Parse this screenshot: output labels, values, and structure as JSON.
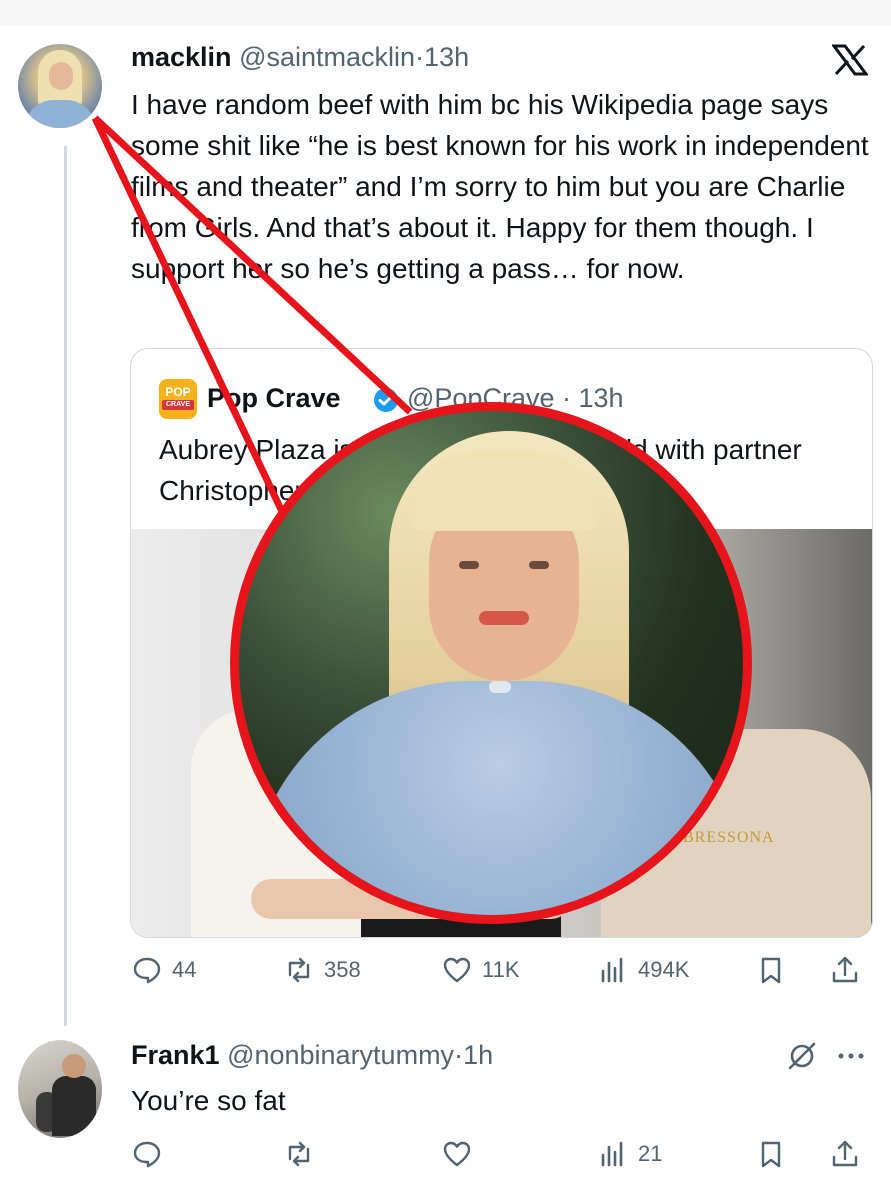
{
  "tweet": {
    "name": "macklin",
    "handle": "@saintmacklin",
    "separator": "·",
    "time": "13h",
    "text": "I have random beef with him bc his Wikipedia page says some shit like “he is best known for his work in independent films and theater” and I’m sorry to him but you are Charlie from Girls. And that’s about it. Happy for them though. I support her so he’s getting a pass… for now.",
    "stats": {
      "replies": "44",
      "reposts": "358",
      "likes": "11K",
      "views": "494K"
    }
  },
  "quote": {
    "logo_text": "POP",
    "logo_subtext": "CRAVE",
    "name": "Pop Crave",
    "handle": "@PopCrave · 13h",
    "text": "Aubrey Plaza is expecting her first child with partner Christopher Abbott, per reports.",
    "photo_brand": "BRESSONA"
  },
  "reply": {
    "name": "Frank1",
    "handle": "@nonbinarytummy",
    "separator": "·",
    "time": "1h",
    "text": "You’re so fat",
    "stats": {
      "views": "21"
    }
  },
  "icons": [
    "x-logo-icon",
    "verified-badge-icon",
    "reply-icon",
    "repost-icon",
    "like-icon",
    "views-icon",
    "bookmark-icon",
    "share-icon",
    "mute-icon",
    "more-icon"
  ],
  "colors": {
    "annotation_red": "#e8141c",
    "secondary_text": "#536471",
    "verified_blue": "#1d9bf0",
    "pop_crave_gold": "#f5b21b"
  }
}
